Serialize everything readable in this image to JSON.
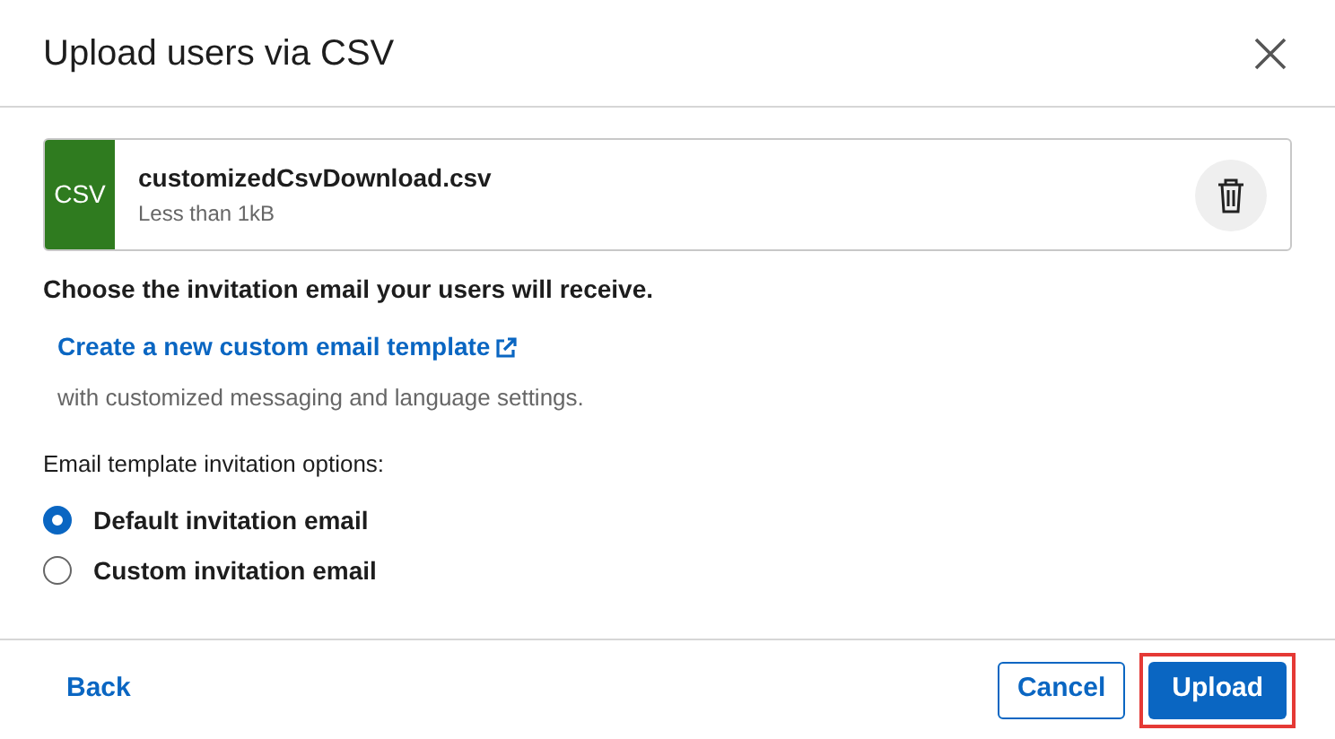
{
  "dialog": {
    "title": "Upload users via CSV"
  },
  "file": {
    "badge": "CSV",
    "name": "customizedCsvDownload.csv",
    "size": "Less than 1kB"
  },
  "prompt": "Choose the invitation email your users will receive.",
  "link": {
    "label": "Create a new custom email template"
  },
  "link_note": "with customized messaging and language settings.",
  "options_label": "Email template invitation options:",
  "options": [
    {
      "label": "Default invitation email",
      "selected": true
    },
    {
      "label": "Custom invitation email",
      "selected": false
    }
  ],
  "footer": {
    "back": "Back",
    "cancel": "Cancel",
    "upload": {
      "label": "Upload",
      "highlighted": true
    }
  }
}
